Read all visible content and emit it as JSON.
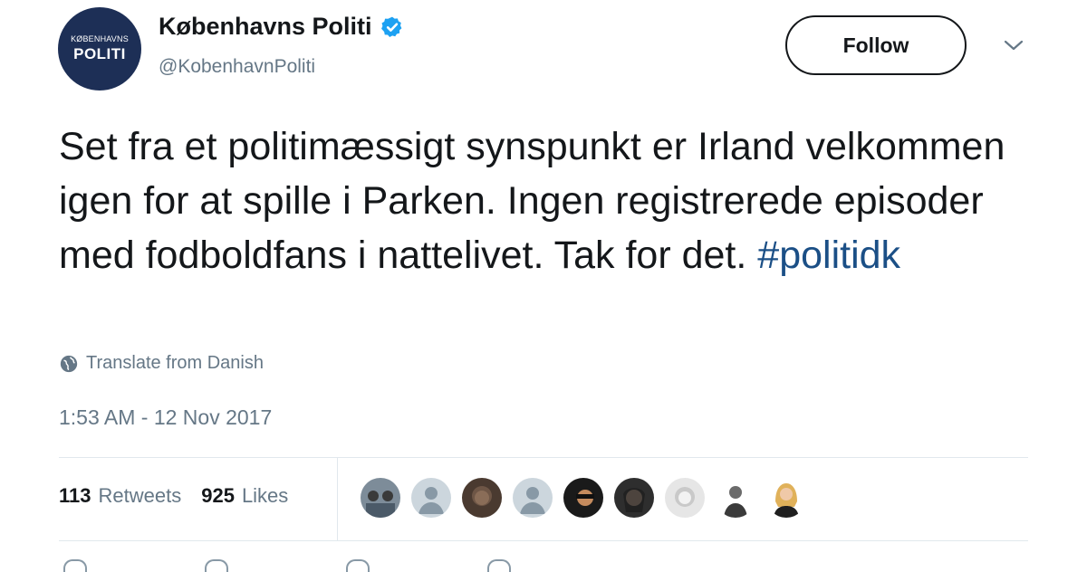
{
  "account": {
    "display_name": "Københavns Politi",
    "handle": "@KobenhavnPoliti",
    "avatar_text_small": "KØBENHAVNS",
    "avatar_text_big": "POLITI",
    "verified_icon": "verified-badge-icon"
  },
  "follow_button": {
    "label": "Follow"
  },
  "tweet": {
    "text_before_hashtag": "Set fra et politimæssigt synspunkt er Irland velkommen igen for at spille i Parken. Ingen registrerede episoder med fodboldfans i nattelivet. Tak for det. ",
    "hashtag": "#politidk",
    "translate_label": "Translate from Danish",
    "timestamp": "1:53 AM - 12 Nov 2017"
  },
  "stats": {
    "retweets_count": "113",
    "retweets_label": "Retweets",
    "likes_count": "925",
    "likes_label": "Likes"
  },
  "likers": [
    {
      "name": "liker-avatar-1",
      "color": "#6b7b8a"
    },
    {
      "name": "liker-avatar-2",
      "color": "#c5cdd6"
    },
    {
      "name": "liker-avatar-3",
      "color": "#5a4a3e"
    },
    {
      "name": "liker-avatar-4",
      "color": "#c5cdd6"
    },
    {
      "name": "liker-avatar-5",
      "color": "#2a2a2a"
    },
    {
      "name": "liker-avatar-6",
      "color": "#3c3c3c"
    },
    {
      "name": "liker-avatar-7",
      "color": "#d9d9d9"
    },
    {
      "name": "liker-avatar-8",
      "color": "#ffffff"
    },
    {
      "name": "liker-avatar-9",
      "color": "#ffffff"
    }
  ],
  "colors": {
    "brand_navy": "#1d2f56",
    "verified_blue": "#1da1f2",
    "link_blue": "#1b4f86",
    "secondary_text": "#657786"
  }
}
